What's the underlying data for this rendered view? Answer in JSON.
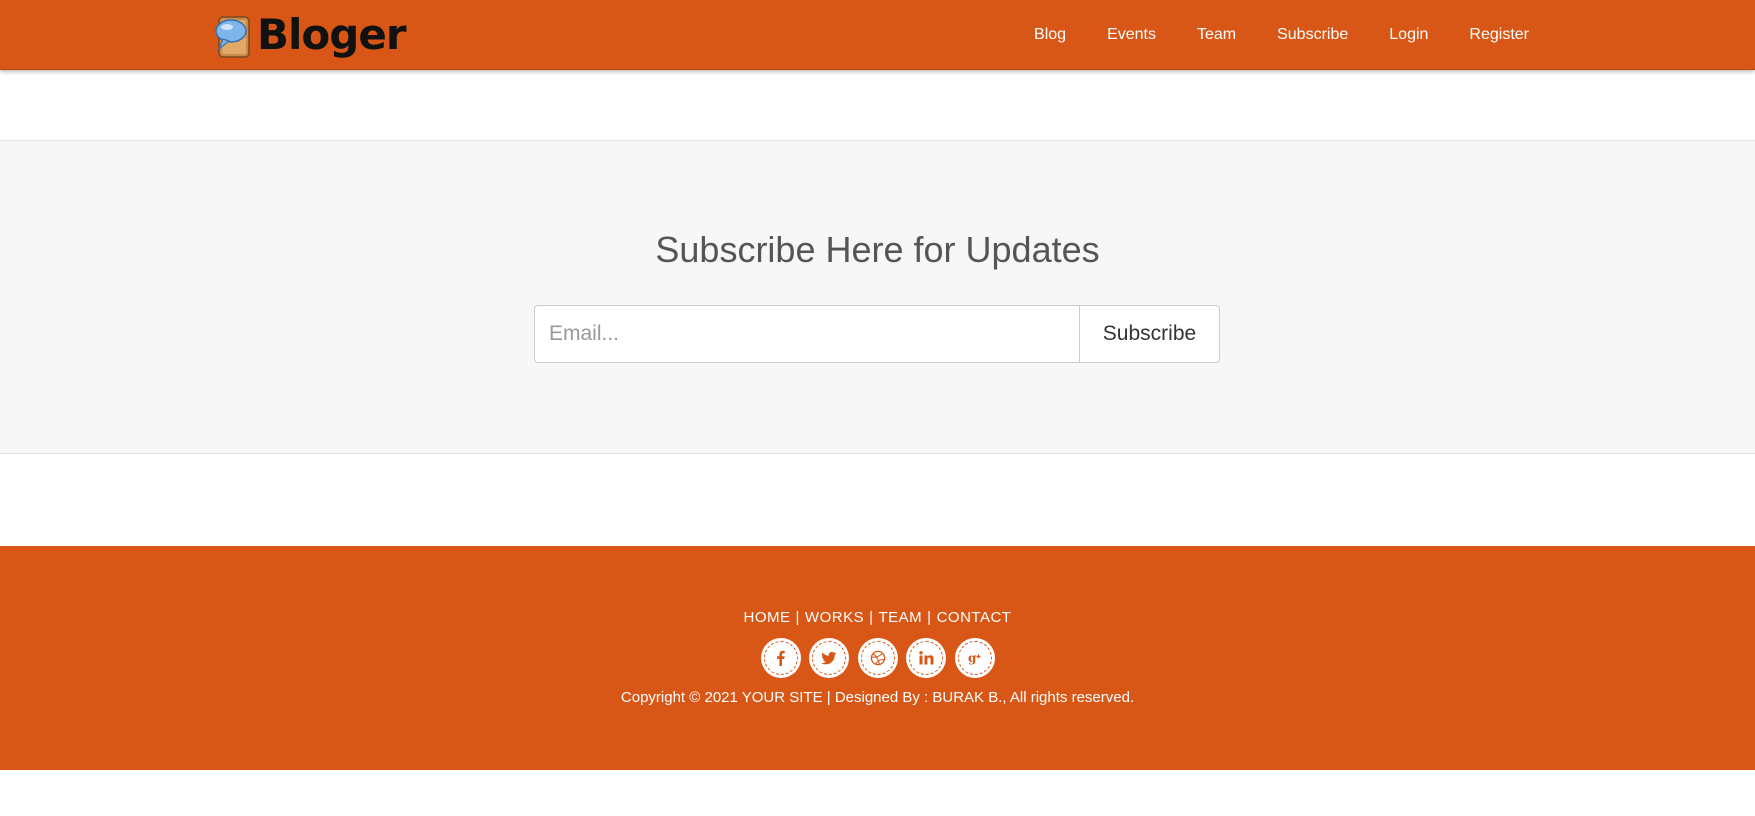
{
  "navbar": {
    "brand": "Bloger",
    "logo_icon": "speech-bubble-book-icon",
    "links": [
      "Blog",
      "Events",
      "Team",
      "Subscribe",
      "Login",
      "Register"
    ]
  },
  "subscribe": {
    "title": "Subscribe Here for Updates",
    "email_placeholder": "Email...",
    "email_value": "",
    "button_label": "Subscribe"
  },
  "footer": {
    "links": [
      "HOME",
      "WORKS",
      "TEAM",
      "CONTACT"
    ],
    "separator": "|",
    "social_icons": [
      "facebook-icon",
      "twitter-icon",
      "dribbble-icon",
      "linkedin-icon",
      "google-plus-icon"
    ],
    "copyright": "Copyright © 2021 YOUR SITE | Designed By : BURAK B., All rights reserved."
  },
  "colors": {
    "accent": "#d85716",
    "section_bg": "#f7f7f7",
    "title_text": "#555555"
  }
}
